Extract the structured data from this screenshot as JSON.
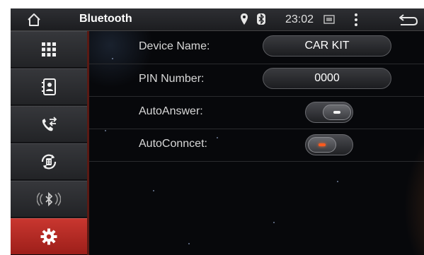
{
  "status_bar": {
    "title": "Bluetooth",
    "time": "23:02",
    "icons": [
      "home-icon",
      "location-pin-icon",
      "bluetooth-icon",
      "screenshot-icon",
      "menu-icon",
      "back-icon"
    ]
  },
  "sidebar": {
    "items": [
      {
        "name": "apps-grid",
        "icon": "grid-icon",
        "active": false
      },
      {
        "name": "contacts",
        "icon": "contacts-icon",
        "active": false
      },
      {
        "name": "call-log",
        "icon": "call-transfer-icon",
        "active": false
      },
      {
        "name": "dialer-sync",
        "icon": "phone-sync-icon",
        "active": false
      },
      {
        "name": "bluetooth-audio",
        "icon": "bluetooth-audio-icon",
        "active": false
      },
      {
        "name": "settings",
        "icon": "settings-gear-icon",
        "active": true
      }
    ]
  },
  "settings": {
    "device_name_label": "Device Name:",
    "device_name_value": "CAR KIT",
    "pin_label": "PIN Number:",
    "pin_value": "0000",
    "auto_answer_label": "AutoAnswer:",
    "auto_answer_on": false,
    "auto_connect_label": "AutoConncet:",
    "auto_connect_on": true
  },
  "colors": {
    "active_tab": "#b52a24",
    "toggle_on_indicator": "#ff5a1e",
    "background": "#07080b"
  }
}
